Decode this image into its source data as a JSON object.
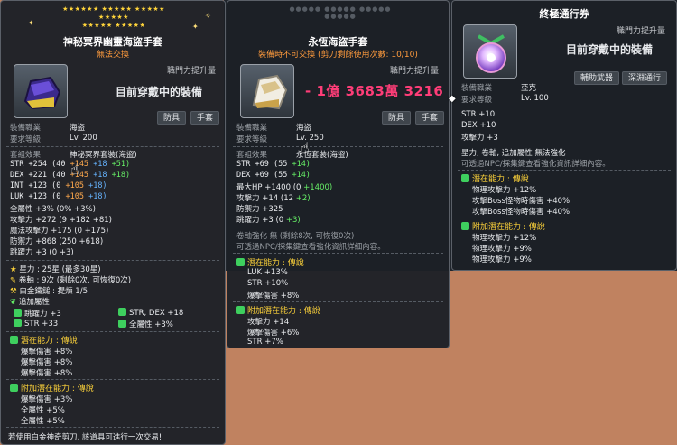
{
  "panel1": {
    "stars_row1": "★★★★★★ ★★★★★ ★★★★★ ★★★★★",
    "stars_row2": "★★★★★ ★★★★★",
    "title": "神秘冥界幽靈海盜手套",
    "subtitle": "無法交換",
    "upgrade_label": "職門力提升量",
    "equipped_text": "目前穿戴中的裝備",
    "tag1": "防具",
    "tag2": "手套",
    "job_label": "裝備職業",
    "job_value": "海盜",
    "req_label": "要求等級",
    "req_value": "Lv. 200",
    "set_label": "套組效果",
    "set_value": "神秘冥界套裝(海盜)",
    "stats": [
      {
        "name": "STR",
        "total": "+254",
        "open": "(40",
        "a": "+145",
        "b": "+18",
        "c": "+51)"
      },
      {
        "name": "DEX",
        "total": "+221",
        "open": "(40",
        "a": "+145",
        "b": "+18",
        "c": "+18)"
      },
      {
        "name": "INT",
        "total": "+123",
        "open": "(0",
        "a": "+105",
        "b": "+18)",
        "c": ""
      },
      {
        "name": "LUK",
        "total": "+123",
        "open": "(0",
        "a": "+105",
        "b": "+18)",
        "c": ""
      }
    ],
    "allstat": "全屬性  +3%  (0%  +3%)",
    "atk": "攻擊力  +272  (9  +182  +81)",
    "matk": "魔法攻擊力  +175  (0  +175)",
    "def": "防禦力  +868  (250  +618)",
    "jump": "跳躍力  +3  (0  +3)",
    "starforce": "星力 : 25星  (最多30星)",
    "scroll": "卷軸 : 9次  (剩餘0次,  可恢復0次)",
    "hammer": "白金鐵鎚 : 提煉  1/5",
    "extra_label": "追加屬性",
    "extra_items": [
      "跳躍力  +3",
      "STR, DEX  +18",
      "STR  +33",
      "全屬性  +3%"
    ],
    "pot_label": "潛在能力 : 傳說",
    "pot_lines": [
      "爆擊傷害  +8%",
      "爆擊傷害  +8%",
      "爆擊傷害  +8%"
    ],
    "addpot_label": "附加潛在能力 : 傳說",
    "addpot_lines": [
      "爆擊傷害  +3%",
      "全屬性  +5%",
      "全屬性  +5%"
    ],
    "footer": "若使用白金神奇剪刀, 該道具可進行一次交易!"
  },
  "panel2": {
    "title": "永恆海盜手套",
    "subtitle": "裝備時不可交換 (剪刀剩餘使用次數: 10/10)",
    "upgrade_label": "職門力提升量",
    "price": "- 1億 3683萬 3216",
    "tag1": "防具",
    "tag2": "手套",
    "job_label": "裝備職業",
    "job_value": "海盜",
    "req_label": "要求等級",
    "req_value": "Lv. 250",
    "set_label": "套組效果",
    "set_value": "永恆套裝(海盜)",
    "stats": [
      {
        "name": "STR",
        "total": "+69",
        "open": "(55",
        "a": "+14)"
      },
      {
        "name": "DEX",
        "total": "+69",
        "open": "(55",
        "a": "+14)"
      },
      {
        "name": "最大HP",
        "total": "+1400",
        "open": "(0",
        "a": "+1400)"
      },
      {
        "name": "攻擊力",
        "total": "+14",
        "open": "(12",
        "a": "+2)"
      },
      {
        "name": "防禦力",
        "total": "+325",
        "open": "",
        "a": ""
      },
      {
        "name": "跳躍力",
        "total": "+3",
        "open": "(0",
        "a": "+3)"
      }
    ],
    "scroll_note": "卷軸強化 無 (剩餘8次, 可恢復0次)",
    "npc_note": "可透過NPC/採集鍵查看強化資訊詳細內容。",
    "pot_label": "潛在能力 : 傳說",
    "pot_lines": [
      "LUK  +13%",
      "STR  +10%",
      "爆擊傷害  +8%"
    ],
    "addpot_label": "附加潛在能力 : 傳說",
    "addpot_lines": [
      "攻擊力  +14",
      "爆擊傷害  +6%",
      "STR  +7%"
    ]
  },
  "panel3": {
    "title": "終極通行券",
    "upgrade_label": "職門力提升量",
    "equipped_text": "目前穿戴中的裝備",
    "tag1": "輔助武器",
    "tag2": "深淵通行",
    "job_label": "裝備職業",
    "job_value": "亞克",
    "req_label": "要求等級",
    "req_value": "Lv. 100",
    "stats": [
      {
        "name": "STR",
        "value": "+10"
      },
      {
        "name": "DEX",
        "value": "+10"
      },
      {
        "name": "攻擊力",
        "value": "+3"
      }
    ],
    "note1": "星力, 卷軸, 追加屬性  無法強化",
    "note2": "可透過NPC/採集鍵查看強化資訊詳細內容。",
    "pot_label": "潛在能力 : 傳說",
    "pot_lines": [
      "物理攻擊力  +12%",
      "攻擊Boss怪物時傷害  +40%",
      "攻擊Boss怪物時傷害  +40%"
    ],
    "addpot_label": "附加潛在能力 : 傳說",
    "addpot_lines": [
      "物理攻擊力  +12%",
      "物理攻擊力  +9%",
      "物理攻擊力  +9%"
    ]
  }
}
